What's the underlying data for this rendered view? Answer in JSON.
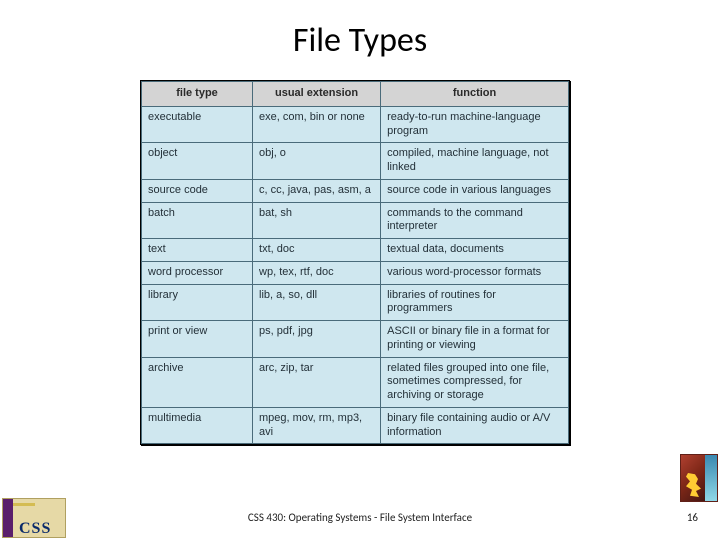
{
  "title": "File Types",
  "table": {
    "headers": {
      "col1": "file type",
      "col2": "usual extension",
      "col3": "function"
    },
    "rows": [
      {
        "type": "executable",
        "ext": "exe, com, bin or none",
        "func": "ready-to-run machine-language program"
      },
      {
        "type": "object",
        "ext": "obj, o",
        "func": "compiled, machine language, not linked"
      },
      {
        "type": "source code",
        "ext": "c, cc, java, pas, asm, a",
        "func": "source code in various languages"
      },
      {
        "type": "batch",
        "ext": "bat, sh",
        "func": "commands to the command interpreter"
      },
      {
        "type": "text",
        "ext": "txt, doc",
        "func": "textual data, documents"
      },
      {
        "type": "word processor",
        "ext": "wp, tex, rtf, doc",
        "func": "various word-processor formats"
      },
      {
        "type": "library",
        "ext": "lib, a, so, dll",
        "func": "libraries of routines for programmers"
      },
      {
        "type": "print or view",
        "ext": "ps, pdf, jpg",
        "func": "ASCII or binary file in a format for printing or viewing"
      },
      {
        "type": "archive",
        "ext": "arc, zip, tar",
        "func": "related files grouped into one file, sometimes compressed, for archiving or storage"
      },
      {
        "type": "multimedia",
        "ext": "mpeg, mov, rm, mp3, avi",
        "func": "binary file containing audio or A/V information"
      }
    ]
  },
  "footer": "CSS 430: Operating Systems - File System Interface",
  "page_number": "16",
  "logos": {
    "left": "CSS",
    "right_alt": "Operating Systems textbook cover"
  }
}
